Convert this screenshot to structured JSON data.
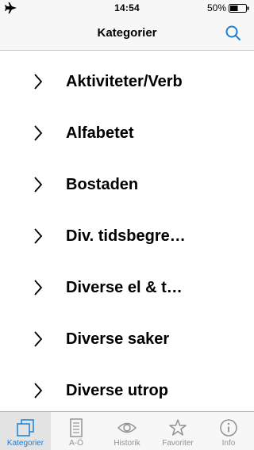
{
  "status_bar": {
    "time": "14:54",
    "battery": "50%",
    "battery_level": 0.5
  },
  "nav": {
    "title": "Kategorier"
  },
  "categories": [
    {
      "label": "Aktiviteter/Verb"
    },
    {
      "label": "Alfabetet"
    },
    {
      "label": "Bostaden"
    },
    {
      "label": "Div. tidsbegre…"
    },
    {
      "label": "Diverse el & t…"
    },
    {
      "label": "Diverse saker"
    },
    {
      "label": "Diverse utrop"
    }
  ],
  "tabs": [
    {
      "label": "Kategorier",
      "icon": "categories-icon",
      "active": true
    },
    {
      "label": "A-Ö",
      "icon": "list-icon"
    },
    {
      "label": "Historik",
      "icon": "eye-icon"
    },
    {
      "label": "Favoriter",
      "icon": "star-icon"
    },
    {
      "label": "Info",
      "icon": "info-icon"
    }
  ],
  "colors": {
    "accent": "#1a7fd6",
    "bar_bg": "#f7f7f7",
    "inactive": "#929292"
  }
}
